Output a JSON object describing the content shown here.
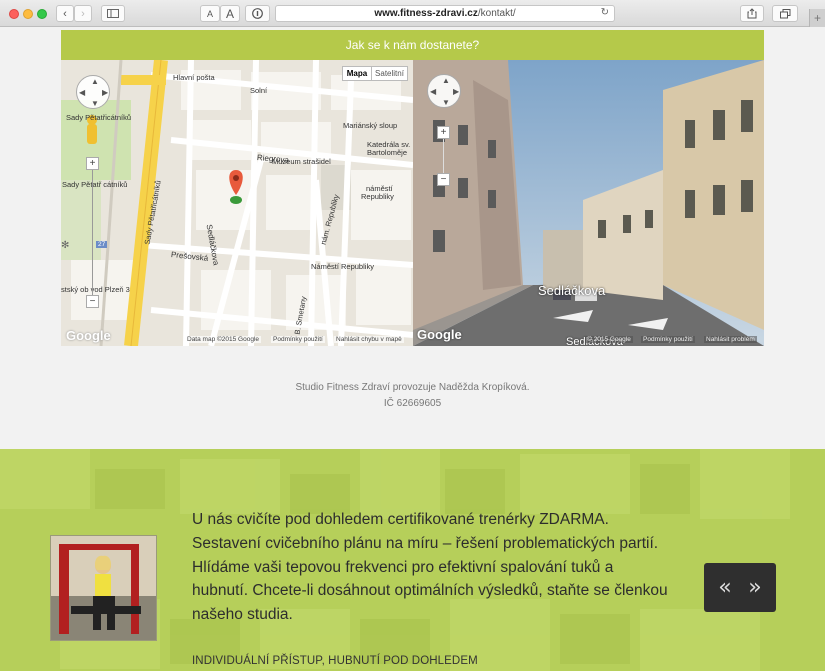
{
  "browser": {
    "url_domain": "www.fitness-zdravi.cz",
    "url_path": "/kontakt/",
    "font_small": "A",
    "font_large": "A",
    "new_tab": "+"
  },
  "how_bar": {
    "title": "Jak se k nám dostanete?"
  },
  "map": {
    "type_map": "Mapa",
    "type_sat": "Satelitní",
    "labels": {
      "hlavni_posta": "Hlavní pošta",
      "solni": "Solní",
      "sady_petatricatniku": "Sady Pětatřicátníků",
      "marianskysloup": "Mariánský sloup",
      "muzeum": "Muzeum strašidel",
      "katedrala1": "Katedrála sv.",
      "katedrala2": "Bartoloměje",
      "riegrova": "Riegrova",
      "namesti1": "náměstí",
      "namesti2": "Republiky",
      "sady2": "Sady Pětatř cátníků",
      "sedlackova": "Sedláčkova",
      "presovska": "Prešovská",
      "namesti_republiky": "Náměstí Republiky",
      "nam_republiky_vert": "nám. Republiky",
      "smetany": "B. Smetany",
      "stesky": "stský ob vod Plzeň 3",
      "sady_vert": "Sady Pětatřicátníků",
      "road27": "27"
    },
    "footer": {
      "data": "Data map ©2015 Google",
      "terms": "Podmínky použití",
      "report": "Nahlásit chybu v mapě"
    },
    "logo": "Google"
  },
  "streetview": {
    "street_label": "Sedláčkova",
    "street_label_bottom": "Sedláčkova",
    "logo": "Google",
    "footer": {
      "copyright": "© 2015 Google",
      "terms": "Podmínky použití",
      "report": "Nahlásit problém"
    }
  },
  "info": {
    "line1": "Studio Fitness Zdraví provozuje Naděžda Kropíková.",
    "line2": "IČ 62669605"
  },
  "promo": {
    "text": "U nás cvičíte pod dohledem certifikované trenérky ZDARMA. Sestavení cvičebního plánu na míru – řešení problematických partií. Hlídáme vaši tepovou frekvenci pro efektivní spalování tuků a hubnutí. Chcete-li dosáhnout optimálních výsledků, staňte se členkou našeho studia.",
    "subtitle": "INDIVIDUÁLNÍ PŘÍSTUP, HUBNUTÍ POD DOHLEDEM",
    "prev": "«",
    "next": "»"
  },
  "colors": {
    "accent_green": "#b5c94a",
    "promo_green": "#b6cf5a",
    "slider_bg": "#2f2f2f"
  }
}
